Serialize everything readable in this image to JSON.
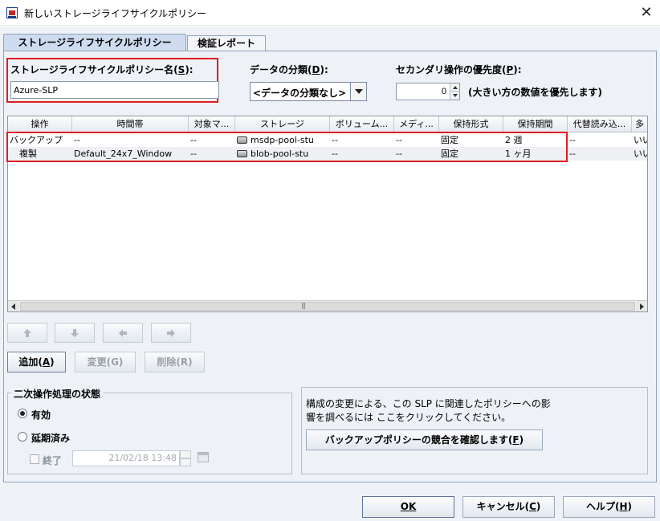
{
  "window": {
    "title": "新しいストレージライフサイクルポリシー",
    "close": "✕"
  },
  "tabs": [
    {
      "label": "ストレージライフサイクルポリシー",
      "active": true
    },
    {
      "label": "検証レポート",
      "active": false
    }
  ],
  "slp_name": {
    "label_text": "ストレージライフサイクルポリシー名(",
    "label_key": "S",
    "label_end": "):",
    "value": "Azure-SLP"
  },
  "data_class": {
    "label_text": "データの分類(",
    "label_key": "D",
    "label_end": "):",
    "value": "<データの分類なし>"
  },
  "priority": {
    "label_text": "セカンダリ操作の優先度(",
    "label_key": "P",
    "label_end": "):",
    "value": "0",
    "hint": "(大きい方の数値を優先します)"
  },
  "table": {
    "columns": [
      "操作",
      "時間帯",
      "対象マ...",
      "ストレージ",
      "ボリューム...",
      "メディ...",
      "保持形式",
      "保持期間",
      "代替読み込...",
      "多"
    ],
    "rows": [
      [
        "バックアップ",
        "--",
        "--",
        "msdp-pool-stu",
        "--",
        "--",
        "固定",
        "2 週",
        "--",
        "いい"
      ],
      [
        "複製",
        "Default_24x7_Window",
        "--",
        "blob-pool-stu",
        "--",
        "--",
        "固定",
        "1 ヶ月",
        "--",
        "いい"
      ]
    ],
    "scroll_grip": "|||"
  },
  "buttons": {
    "add_text": "追加(",
    "add_key": "A",
    "add_end": ")",
    "change": "変更(G)",
    "delete": "削除(R)",
    "check_text": "バックアップポリシーの競合を確認します(",
    "check_key": "F",
    "check_end": ")",
    "ok": "OK",
    "cancel_text": "キャンセル(",
    "cancel_key": "C",
    "cancel_end": ")",
    "help_text": "ヘルプ(",
    "help_key": "H",
    "help_end": ")"
  },
  "secondary_status": {
    "legend": "二次操作処理の状態",
    "enabled": "有効",
    "postponed": "延期済み",
    "end_label": "終了",
    "end_date": "21/02/18 13:48"
  },
  "impact": {
    "line1": "構成の変更による、この SLP に関連したポリシーへの影",
    "line2": "響を調べるには ここをクリックしてください。"
  }
}
